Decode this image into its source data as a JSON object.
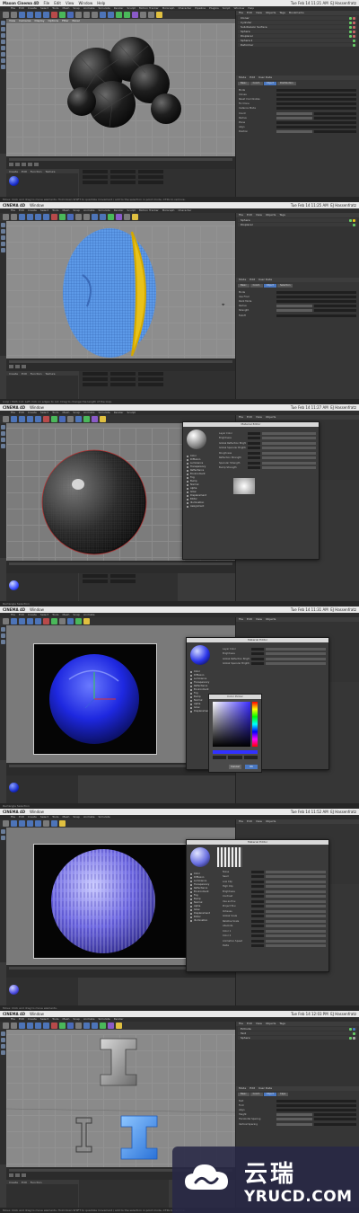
{
  "frames": [
    {
      "app_name": "Maxon Cinema 4D",
      "mac_menu": [
        "File",
        "Edit",
        "View",
        "Window",
        "Help"
      ],
      "clock": "Tue Feb 14 11:21 AM",
      "user": "EJ Hassenfratz",
      "c4d_menu": [
        "File",
        "Edit",
        "Create",
        "Select",
        "Tools",
        "Mesh",
        "Snap",
        "Animate",
        "Simulate",
        "Render",
        "Sculpt",
        "Motion Tracker",
        "MoGraph",
        "Character",
        "Pipeline",
        "Plugins",
        "Script",
        "Window",
        "Help"
      ],
      "viewport_menu": [
        "View",
        "Cameras",
        "Display",
        "Options",
        "Filter",
        "Panel"
      ],
      "objects": [
        "Cloner",
        "Cylinder",
        "Subdivision Surface",
        "Sphere",
        "Displacer",
        "Sphere.1",
        "Deformer"
      ],
      "attr_header": [
        "Mode",
        "Edit",
        "User Data"
      ],
      "attr_tabs": [
        "Basic",
        "Coord.",
        "Object",
        "Distribution"
      ],
      "attr_rows": [
        "Mode",
        "Clones",
        "Reset Coordinates",
        "Fix Clone",
        "Instance Mode",
        "Count",
        "Radius",
        "Plane",
        "Align",
        "Position"
      ],
      "material_tabs": [
        "Create",
        "Edit",
        "Function",
        "Texture"
      ],
      "status": "Move: Click and drag to move elements. Hold down SHIFT to quantize movement / add to the selection in point mode, CTRL to remove."
    },
    {
      "app_name": "CINEMA 4D",
      "mac_menu": [
        "Window"
      ],
      "clock": "Tue Feb 14 11:25 AM",
      "user": "EJ Hassenfratz",
      "objects": [
        "Sphere",
        "Displacer"
      ],
      "attr_tabs": [
        "Basic",
        "Coord.",
        "Object",
        "Selection"
      ],
      "attr_rows": [
        "Mode",
        "Use Floor",
        "Paint Mode",
        "Radius",
        "Strength",
        "Falloff"
      ],
      "status": "Loop / Path Cut: Left click on edges to cut. Drag to change the length of the loop."
    },
    {
      "app_name": "CINEMA 4D",
      "mac_menu": [
        "Window"
      ],
      "clock": "Tue Feb 14 11:27 AM",
      "user": "EJ Hassenfratz",
      "dialog_title": "Material Editor",
      "channels": [
        "Color",
        "Diffusion",
        "Luminance",
        "Transparency",
        "Reflectance",
        "Environment",
        "Fog",
        "Bump",
        "Normal",
        "Alpha",
        "Glow",
        "Displacement",
        "Editor",
        "Illumination",
        "Assignment"
      ],
      "reflectance_rows": [
        "Layer Color",
        "Brightness",
        "Global Reflection Brightness",
        "Global Specular Brightness",
        "Roughness",
        "Reflection Strength",
        "Specular Strength",
        "Bump Strength"
      ],
      "status": "Rectangle Selection"
    },
    {
      "app_name": "CINEMA 4D",
      "mac_menu": [
        "Window"
      ],
      "clock": "Tue Feb 14 11:31 AM",
      "user": "EJ Hassenfratz",
      "dialog_title": "Material Editor",
      "picker_title": "Color Picker",
      "picker_buttons": [
        "Cancel",
        "OK"
      ],
      "status": "Rectangle Selection"
    },
    {
      "app_name": "CINEMA 4D",
      "mac_menu": [
        "Window"
      ],
      "clock": "Tue Feb 14 11:52 AM",
      "user": "EJ Hassenfratz",
      "dialog_title": "Material Editor",
      "shader_rows": [
        "Noise",
        "Seed",
        "Low Clip",
        "High Clip",
        "Brightness",
        "Contrast",
        "Use as Env.",
        "Project Env.",
        "Octaves",
        "Global Scale",
        "Relative Scale",
        "Absolute",
        "Color 1",
        "Color 2",
        "Animation Speed",
        "Delta"
      ],
      "status": "Move: Click and drag to move elements."
    },
    {
      "app_name": "CINEMA 4D",
      "mac_menu": [
        "Window"
      ],
      "clock": "Tue Feb 14 12:03 PM",
      "user": "EJ Hassenfratz",
      "objects": [
        "Extrude",
        "Text",
        "Sphere"
      ],
      "attr_tabs": [
        "Basic",
        "Coord.",
        "Object",
        "Caps"
      ],
      "attr_rows": [
        "Text",
        "Font",
        "Align",
        "Height",
        "Horizontal Spacing",
        "Vertical Spacing"
      ],
      "status": "Move: Click and drag to move elements. Hold down SHIFT to quantize movement / add to the selection in point mode, CTRL to remove."
    }
  ],
  "watermark": {
    "cn": "云瑞",
    "en": "YRUCD.COM"
  },
  "colors": {
    "ui_dark": "#3a3a3a",
    "panel": "#333333",
    "accent": "#4a78c2",
    "mesh_blue": "#4a90e2",
    "selection_yellow": "#e8c21a",
    "material_blue": "#2030ff"
  }
}
